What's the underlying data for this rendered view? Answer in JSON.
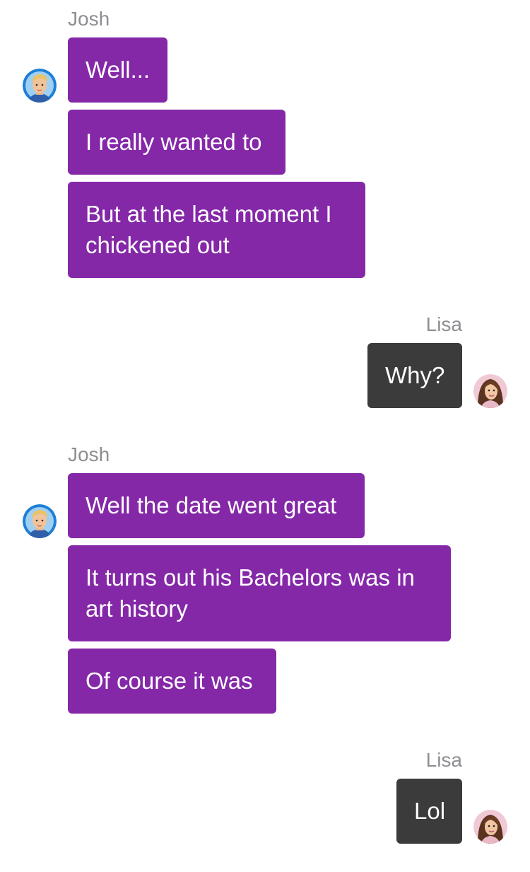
{
  "conversation": {
    "groups": [
      {
        "sender": "Josh",
        "messages": [
          "Well...",
          "I really wanted to",
          "But at the last moment I chickened out"
        ]
      },
      {
        "sender": "Lisa",
        "messages": [
          "Why?"
        ]
      },
      {
        "sender": "Josh",
        "messages": [
          "Well the date went great",
          "It turns out his Bachelors was in art history",
          "Of course it was"
        ]
      },
      {
        "sender": "Lisa",
        "messages": [
          "Lol"
        ]
      }
    ]
  },
  "colors": {
    "josh_bubble": "#8428a8",
    "lisa_bubble": "#3b3b3b",
    "sender_name": "#8e8e93",
    "bubble_text": "#ffffff"
  },
  "avatars": {
    "josh": "josh-avatar",
    "lisa": "lisa-avatar"
  }
}
